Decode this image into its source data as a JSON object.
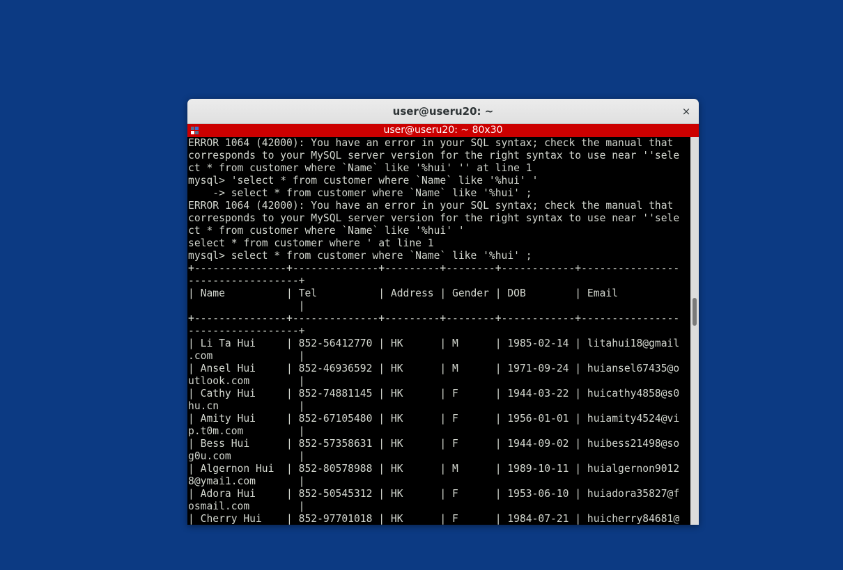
{
  "window": {
    "title": "user@useru20: ~",
    "close_label": "×"
  },
  "tab": {
    "title": "user@useru20: ~ 80x30",
    "icon": "terminal-tab-icon"
  },
  "terminal": {
    "lines": [
      "ERROR 1064 (42000): You have an error in your SQL syntax; check the manual that",
      "corresponds to your MySQL server version for the right syntax to use near ''sele",
      "ct * from customer where `Name` like '%hui' '' at line 1",
      "mysql> 'select * from customer where `Name` like '%hui' '",
      "    -> select * from customer where `Name` like '%hui' ;",
      "ERROR 1064 (42000): You have an error in your SQL syntax; check the manual that",
      "corresponds to your MySQL server version for the right syntax to use near ''sele",
      "ct * from customer where `Name` like '%hui' '",
      "select * from customer where ' at line 1",
      "mysql> select * from customer where `Name` like '%hui' ;",
      "+---------------+--------------+---------+--------+------------+----------------",
      "------------------+",
      "| Name          | Tel          | Address | Gender | DOB        | Email",
      "                  |",
      "+---------------+--------------+---------+--------+------------+----------------",
      "------------------+",
      "| Li Ta Hui     | 852-56412770 | HK      | M      | 1985-02-14 | litahui18@gmail",
      ".com              |",
      "| Ansel Hui     | 852-46936592 | HK      | M      | 1971-09-24 | huiansel67435@o",
      "utlook.com        |",
      "| Cathy Hui     | 852-74881145 | HK      | F      | 1944-03-22 | huicathy4858@s0",
      "hu.cn             |",
      "| Amity Hui     | 852-67105480 | HK      | F      | 1956-01-01 | huiamity4524@vi",
      "p.t0m.com         |",
      "| Bess Hui      | 852-57358631 | HK      | F      | 1944-09-02 | huibess21498@so",
      "g0u.com           |",
      "| Algernon Hui  | 852-80578988 | HK      | M      | 1989-10-11 | huialgernon9012",
      "8@ymai1.com       |",
      "| Adora Hui     | 852-50545312 | HK      | F      | 1953-06-10 | huiadora35827@f",
      "osmail.com        |",
      "| Cherry Hui    | 852-97701018 | HK      | F      | 1984-07-21 | huicherry84681@"
    ]
  },
  "colors": {
    "desktop": "#0c3a83",
    "tabbar": "#cc0000",
    "terminal_bg": "#000000",
    "terminal_fg": "#d3d7cf"
  }
}
